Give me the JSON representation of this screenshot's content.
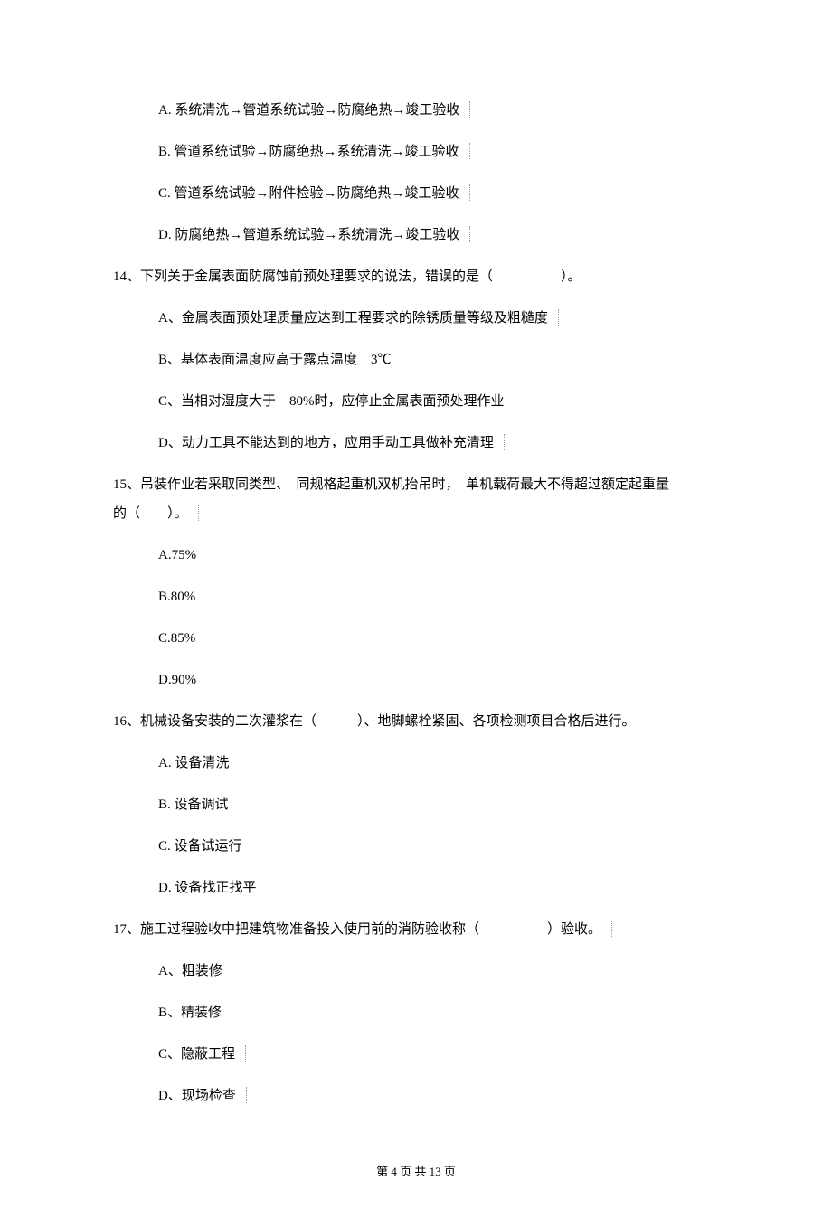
{
  "q13_options": {
    "a": "A. 系统清洗→管道系统试验→防腐绝热→竣工验收",
    "b": "B. 管道系统试验→防腐绝热→系统清洗→竣工验收",
    "c": "C. 管道系统试验→附件检验→防腐绝热→竣工验收",
    "d": "D. 防腐绝热→管道系统试验→系统清洗→竣工验收"
  },
  "q14": {
    "text": "14、下列关于金属表面防腐蚀前预处理要求的说法，错误的是（　　　　　）。",
    "a": "A、金属表面预处理质量应达到工程要求的除锈质量等级及粗糙度",
    "b": "B、基体表面温度应高于露点温度　3℃",
    "c": "C、当相对湿度大于　80%时，应停止金属表面预处理作业",
    "d": "D、动力工具不能达到的地方，应用手动工具做补充清理"
  },
  "q15": {
    "text_l1": "15、吊装作业若采取同类型、　同规格起重机双机抬吊时，　单机载荷最大不得超过额定起重量",
    "text_l2": "的（　　）。",
    "a": "A.75%",
    "b": "B.80%",
    "c": "C.85%",
    "d": "D.90%"
  },
  "q16": {
    "text": "16、机械设备安装的二次灌浆在（　　　）、地脚螺栓紧固、各项检测项目合格后进行。",
    "a": "A. 设备清洗",
    "b": "B. 设备调试",
    "c": "C. 设备试运行",
    "d": "D. 设备找正找平"
  },
  "q17": {
    "text": "17、施工过程验收中把建筑物准备投入使用前的消防验收称（　　　　　）验收。",
    "a": "A、粗装修",
    "b": "B、精装修",
    "c": "C、隐蔽工程",
    "d": "D、现场检查"
  },
  "footer": {
    "text": "第 4 页 共 13 页"
  }
}
